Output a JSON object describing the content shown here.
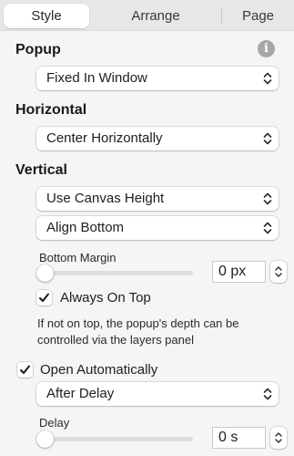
{
  "tabs": [
    {
      "label": "Style",
      "active": true
    },
    {
      "label": "Arrange",
      "active": false
    },
    {
      "label": "Page",
      "active": false
    }
  ],
  "popup": {
    "title": "Popup",
    "info_icon": "i",
    "mode": "Fixed In Window"
  },
  "horizontal": {
    "title": "Horizontal",
    "mode": "Center Horizontally"
  },
  "vertical": {
    "title": "Vertical",
    "height_mode": "Use Canvas Height",
    "align": "Align Bottom",
    "bottom_margin_label": "Bottom Margin",
    "bottom_margin_value": "0 px",
    "bottom_margin_slider": 0,
    "always_on_top_label": "Always On Top",
    "always_on_top_checked": true,
    "note": "If not on top, the popup's depth can be controlled via the layers panel"
  },
  "open": {
    "auto_label": "Open Automatically",
    "auto_checked": true,
    "trigger": "After Delay",
    "delay_label": "Delay",
    "delay_value": "0 s",
    "delay_slider": 0
  },
  "colors": {
    "panel_bg": "#f5f5f5",
    "tabbar_bg": "#e7e7e7",
    "info_icon": "#a7a7a7"
  }
}
